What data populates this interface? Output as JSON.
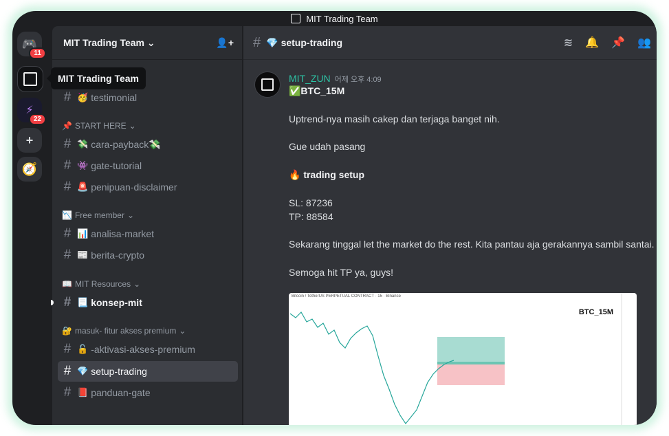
{
  "window_title": "MIT Trading Team",
  "servers": {
    "dm_badge": "11",
    "other_badge": "22",
    "tooltip": "MIT Trading Team"
  },
  "sidebar": {
    "guild_name": "MIT Trading Team",
    "categories": [
      {
        "emoji": "📌",
        "label": "START HERE"
      },
      {
        "emoji": "📉",
        "label": "Free member"
      },
      {
        "emoji": "📖",
        "label": "MIT Resources"
      },
      {
        "emoji": "🔐",
        "label": "masuk- fitur akses premium"
      }
    ],
    "channels": [
      {
        "emoji": "🥳",
        "label": "testimonial"
      },
      {
        "emoji": "💸",
        "label": "cara-payback💸"
      },
      {
        "emoji": "👾",
        "label": "gate-tutorial"
      },
      {
        "emoji": "🚨",
        "label": "penipuan-disclaimer"
      },
      {
        "emoji": "📊",
        "label": "analisa-market"
      },
      {
        "emoji": "📰",
        "label": "berita-crypto"
      },
      {
        "emoji": "📃",
        "label": "konsep-mit"
      },
      {
        "emoji": "🔓",
        "label": "-aktivasi-akses-premium"
      },
      {
        "emoji": "💎",
        "label": "setup-trading"
      },
      {
        "emoji": "📕",
        "label": "panduan-gate"
      }
    ]
  },
  "header": {
    "emoji": "💎",
    "channel_name": "setup-trading"
  },
  "message": {
    "author": "MIT_ZUN",
    "timestamp": "어제 오후 4:09",
    "title": "✅BTC_15M",
    "line1": "Uptrend-nya masih cakep dan terjaga banget nih.",
    "line2": "Gue udah pasang",
    "setup": "🔥 trading setup",
    "sl": "SL: 87236",
    "tp": "TP: 88584",
    "line3": "Sekarang tinggal let the market do the rest. Kita pantau aja gerakannya sambil santai.",
    "line4": "Semoga hit TP ya, guys!"
  },
  "image": {
    "caption": "Bitcoin / TetherUS PERPETUAL CONTRACT · 15 · Binance",
    "label": "BTC_15M"
  },
  "colors": {
    "username": "#2dc3a5",
    "accent": "#5865f2",
    "bg": "#313338"
  }
}
